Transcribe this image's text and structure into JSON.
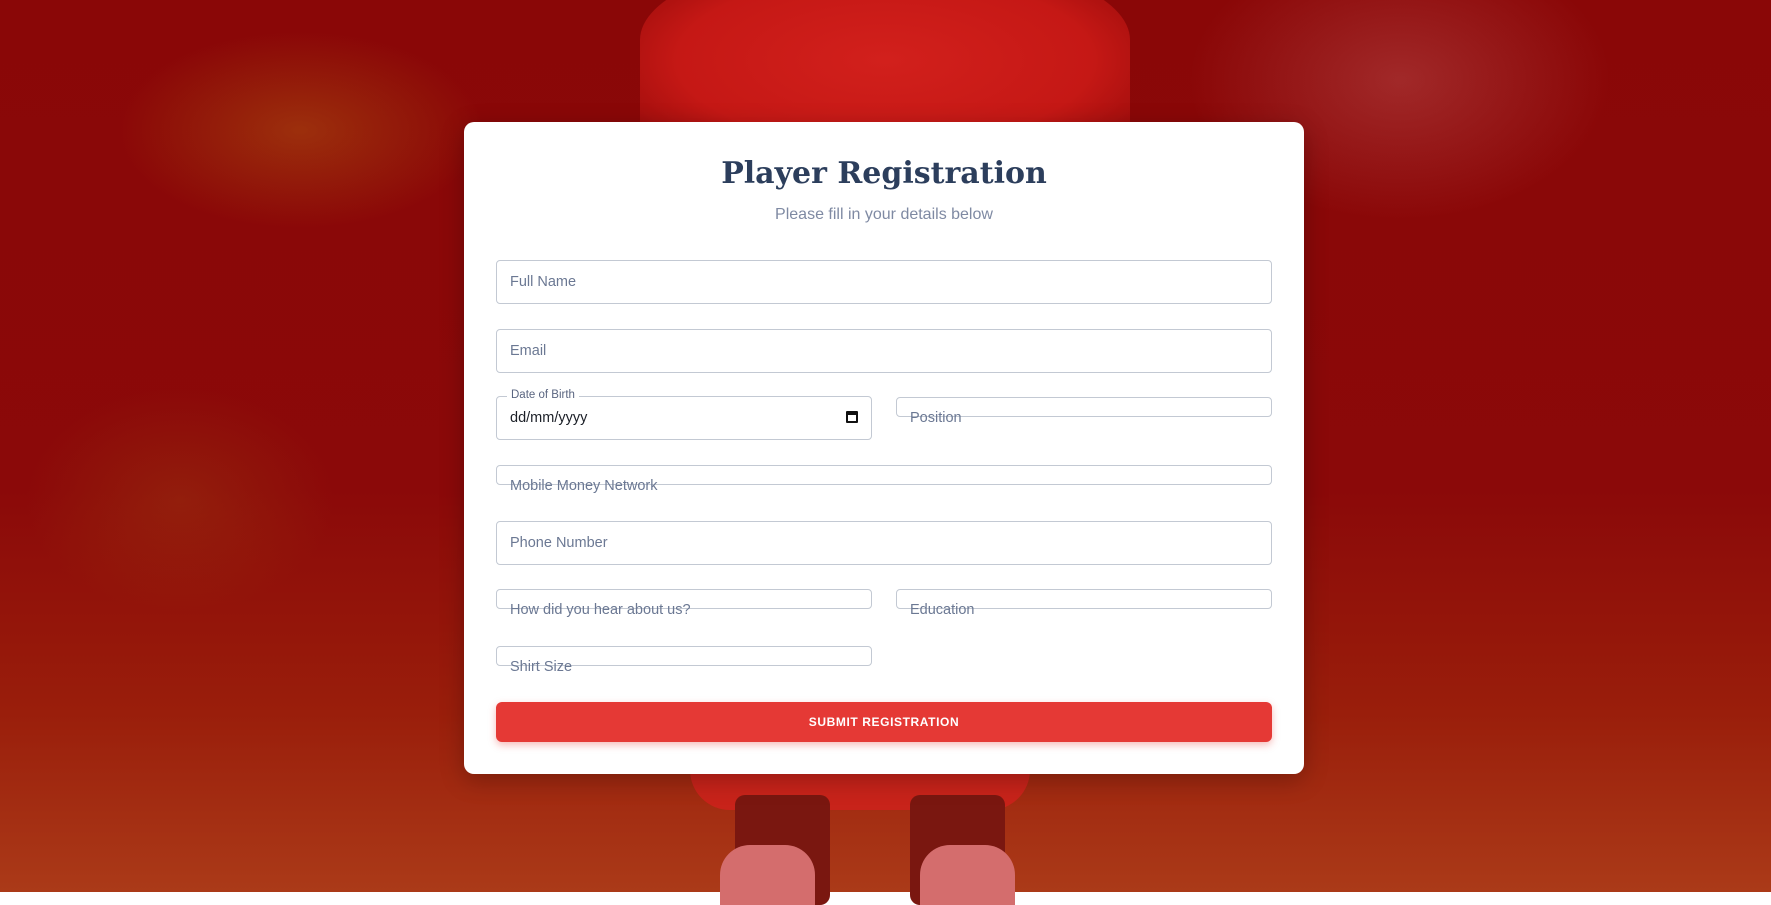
{
  "form": {
    "title": "Player Registration",
    "subtitle": "Please fill in your details below",
    "fields": {
      "full_name": "Full Name",
      "email": "Email",
      "dob_label": "Date of Birth",
      "dob_value": "dd/mm/yyyy",
      "position": "Position",
      "mobile_money_network": "Mobile Money Network",
      "phone_number": "Phone Number",
      "hear_about_us": "How did you hear about us?",
      "education": "Education",
      "shirt_size": "Shirt Size"
    },
    "submit_label": "SUBMIT REGISTRATION"
  },
  "colors": {
    "background_tint": "#8b0909",
    "title": "#2c3e5c",
    "accent": "#e53935"
  },
  "icons": {
    "date_picker": "calendar-icon"
  }
}
